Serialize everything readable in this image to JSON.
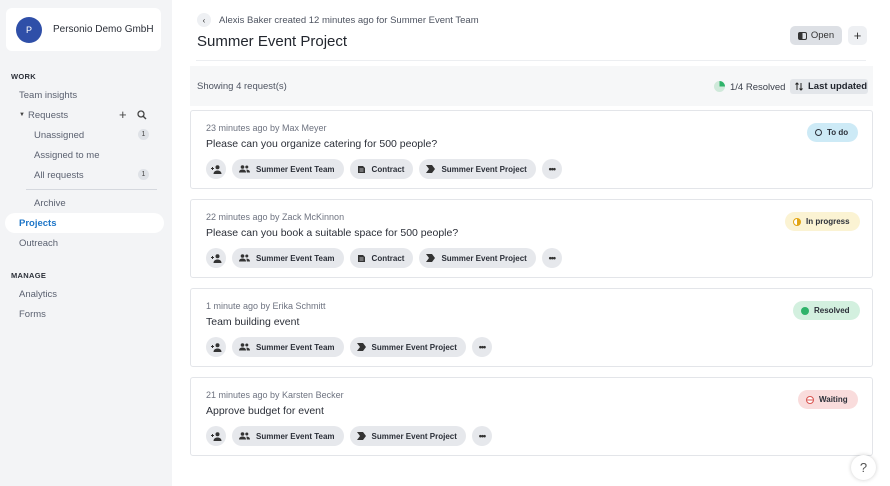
{
  "org": {
    "initial": "P",
    "name": "Personio Demo GmbH"
  },
  "sidebar": {
    "work_label": "WORK",
    "team_insights": "Team insights",
    "requests": "Requests",
    "unassigned": "Unassigned",
    "unassigned_count": "1",
    "assigned_to_me": "Assigned to me",
    "all_requests": "All requests",
    "all_requests_count": "1",
    "archive": "Archive",
    "projects": "Projects",
    "outreach": "Outreach",
    "manage_label": "MANAGE",
    "analytics": "Analytics",
    "forms": "Forms"
  },
  "header": {
    "breadcrumb": "Alexis Baker created 12 minutes ago for Summer Event Team",
    "title": "Summer Event Project",
    "open_label": "Open",
    "add_label": "+"
  },
  "toolbar": {
    "showing": "Showing 4 request(s)",
    "resolved": "1/4 Resolved",
    "sort_label": "Last updated"
  },
  "requests": [
    {
      "meta": "23 minutes ago by Max Meyer",
      "title": "Please can you organize catering for 500 people?",
      "status": "To do",
      "tags": [
        "Summer Event Team",
        "Contract",
        "Summer Event Project"
      ]
    },
    {
      "meta": "22 minutes ago by Zack McKinnon",
      "title": "Please can you book a suitable space for 500 people?",
      "status": "In progress",
      "tags": [
        "Summer Event Team",
        "Contract",
        "Summer Event Project"
      ]
    },
    {
      "meta": "1 minute ago by Erika Schmitt",
      "title": "Team building event",
      "status": "Resolved",
      "tags": [
        "Summer Event Team",
        "Summer Event Project"
      ]
    },
    {
      "meta": "21 minutes ago by Karsten Becker",
      "title": "Approve budget for event",
      "status": "Waiting",
      "tags": [
        "Summer Event Team",
        "Summer Event Project"
      ]
    }
  ],
  "colors": {
    "accent": "#1e76c8",
    "todo_bg": "#cdeaf6",
    "inprogress_bg": "#fbf3d3",
    "resolved_bg": "#d3f0df",
    "waiting_bg": "#f9dcdc"
  },
  "help": "?"
}
